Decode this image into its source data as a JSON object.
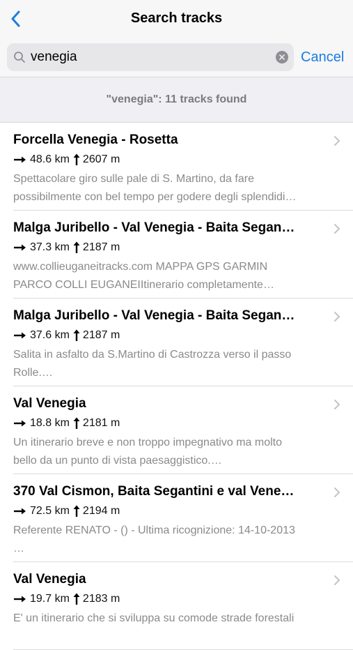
{
  "nav": {
    "title": "Search tracks"
  },
  "search": {
    "value": "venegia",
    "cancel_label": "Cancel"
  },
  "results": {
    "summary": "\"venegia\": 11 tracks found"
  },
  "tracks": [
    {
      "title": "Forcella Venegia - Rosetta",
      "distance": "48.6 km",
      "elevation": "2607 m",
      "desc_line1": "Spettacolare giro sulle pale di S. Martino, da fare",
      "desc_line2": "possibilmente con bel tempo per godere degli splendidi…"
    },
    {
      "title": "Malga Juribello - Val Venegia - Baita Segan…",
      "distance": "37.3 km",
      "elevation": "2187 m",
      "desc_line1": "www.collieuganeitracks.com MAPPA GPS GARMIN",
      "desc_line2": "PARCO COLLI EUGANEIItinerario completamente…"
    },
    {
      "title": "Malga Juribello - Val Venegia - Baita Segan…",
      "distance": "37.6 km",
      "elevation": "2187 m",
      "desc_line1": "Salita in asfalto da S.Martino di Castrozza verso il passo",
      "desc_line2": "Rolle.…"
    },
    {
      "title": "Val Venegia",
      "distance": "18.8 km",
      "elevation": "2181 m",
      "desc_line1": "Un itinerario breve e non troppo impegnativo ma molto",
      "desc_line2": "bello da un punto di vista paesaggistico.…"
    },
    {
      "title": "370 Val Cismon, Baita Segantini e val Vene…",
      "distance": "72.5 km",
      "elevation": "2194 m",
      "desc_line1": "Referente RENATO - () - Ultima ricognizione: 14-10-2013",
      "desc_line2": "…"
    },
    {
      "title": "Val Venegia",
      "distance": "19.7 km",
      "elevation": "2183 m",
      "desc_line1": "E' un itinerario che si sviluppa su comode strade forestali",
      "desc_line2": ""
    }
  ],
  "colors": {
    "accent": "#1a7de0",
    "secondary_text": "#8a8a8e"
  }
}
